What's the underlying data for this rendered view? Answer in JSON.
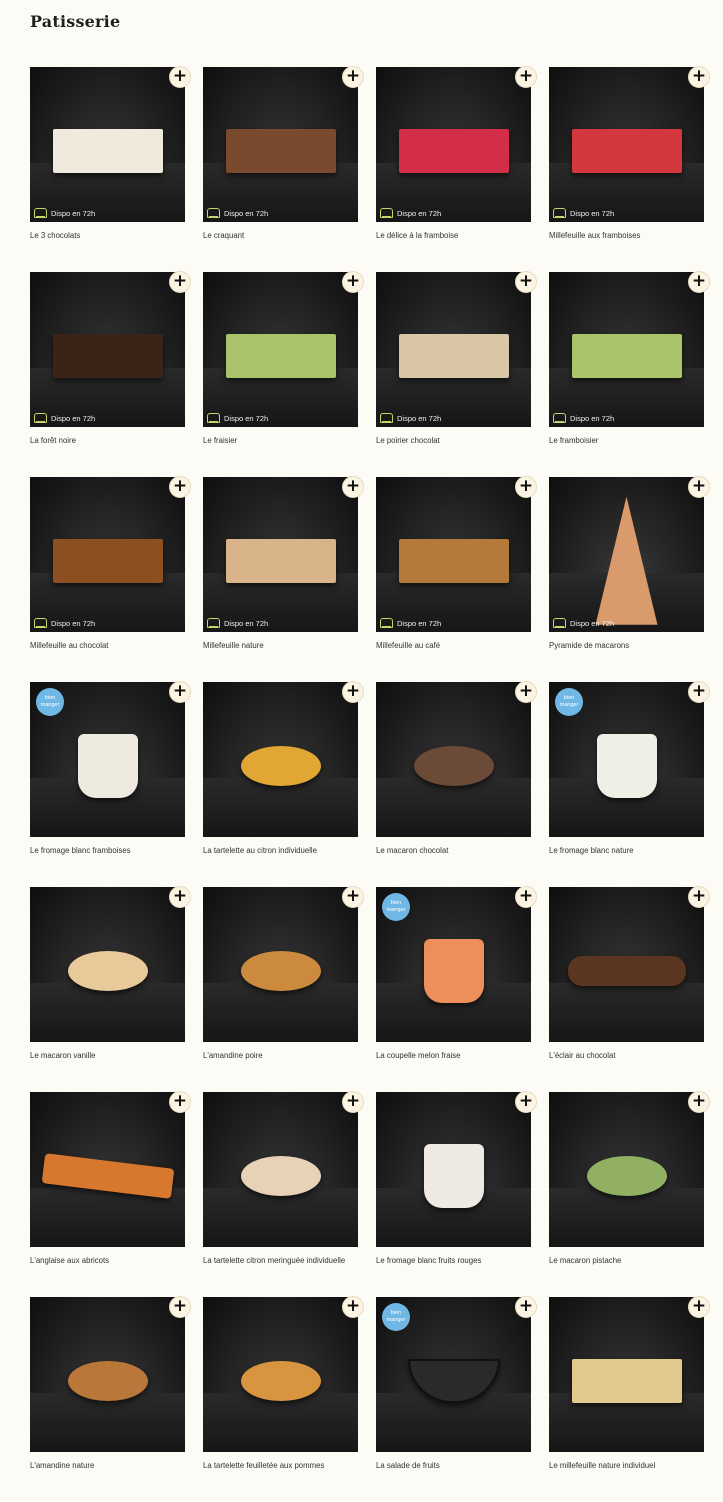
{
  "page": {
    "title": "Patisserie"
  },
  "availability_label": "Dispo en 72h",
  "badge_label": "bien manger",
  "products": [
    {
      "name": "Le 3 chocolats",
      "dispo": true,
      "badge": false,
      "shape": "slab",
      "color": "#efeadb"
    },
    {
      "name": "Le craquant",
      "dispo": true,
      "badge": false,
      "shape": "slab",
      "color": "#7a4a2e"
    },
    {
      "name": "Le délice à la framboise",
      "dispo": true,
      "badge": false,
      "shape": "slab",
      "color": "#d32d48"
    },
    {
      "name": "Millefeuille aux framboises",
      "dispo": true,
      "badge": false,
      "shape": "slab",
      "color": "#d3383f"
    },
    {
      "name": "La forêt noire",
      "dispo": true,
      "badge": false,
      "shape": "slab",
      "color": "#3a2418"
    },
    {
      "name": "Le fraisier",
      "dispo": true,
      "badge": false,
      "shape": "slab",
      "color": "#a8c36a"
    },
    {
      "name": "Le poirier chocolat",
      "dispo": true,
      "badge": false,
      "shape": "slab",
      "color": "#d8c6a4"
    },
    {
      "name": "Le framboisier",
      "dispo": true,
      "badge": false,
      "shape": "slab",
      "color": "#a9c46b"
    },
    {
      "name": "Millefeuille au chocolat",
      "dispo": true,
      "badge": false,
      "shape": "slab",
      "color": "#8b4f22"
    },
    {
      "name": "Millefeuille nature",
      "dispo": true,
      "badge": false,
      "shape": "slab",
      "color": "#d9b48a"
    },
    {
      "name": "Millefeuille au café",
      "dispo": true,
      "badge": false,
      "shape": "slab",
      "color": "#b57a3a"
    },
    {
      "name": "Pyramide de macarons",
      "dispo": true,
      "badge": false,
      "shape": "tower",
      "color": "#d99a6c"
    },
    {
      "name": "Le fromage blanc framboises",
      "dispo": false,
      "badge": true,
      "shape": "cup",
      "color": "#eeeae0"
    },
    {
      "name": "La tartelette au citron individuelle",
      "dispo": false,
      "badge": false,
      "shape": "round",
      "color": "#e2a634"
    },
    {
      "name": "Le macaron chocolat",
      "dispo": false,
      "badge": false,
      "shape": "round",
      "color": "#6b4a37"
    },
    {
      "name": "Le fromage blanc nature",
      "dispo": false,
      "badge": true,
      "shape": "cup",
      "color": "#eef0e6"
    },
    {
      "name": "Le macaron vanille",
      "dispo": false,
      "badge": false,
      "shape": "round",
      "color": "#e7c99a"
    },
    {
      "name": "L'amandine poire",
      "dispo": false,
      "badge": false,
      "shape": "round",
      "color": "#cc8a3e"
    },
    {
      "name": "La coupelle melon fraise",
      "dispo": false,
      "badge": true,
      "shape": "cup",
      "color": "#ec8f5a"
    },
    {
      "name": "L'éclair au chocolat",
      "dispo": false,
      "badge": false,
      "shape": "eclair",
      "color": "#5a3520"
    },
    {
      "name": "L'anglaise aux abricots",
      "dispo": false,
      "badge": false,
      "shape": "strip",
      "color": "#d8782e"
    },
    {
      "name": "La tartelette citron meringuée individuelle",
      "dispo": false,
      "badge": false,
      "shape": "round",
      "color": "#e7d2b8"
    },
    {
      "name": "Le fromage blanc fruits rouges",
      "dispo": false,
      "badge": false,
      "shape": "cup",
      "color": "#eee9e3"
    },
    {
      "name": "Le macaron pistache",
      "dispo": false,
      "badge": false,
      "shape": "round",
      "color": "#92b062"
    },
    {
      "name": "L'amandine nature",
      "dispo": false,
      "badge": false,
      "shape": "round",
      "color": "#b9773a"
    },
    {
      "name": "La tartelette feuilletée aux pommes",
      "dispo": false,
      "badge": false,
      "shape": "round",
      "color": "#d99440"
    },
    {
      "name": "La salade de fruits",
      "dispo": false,
      "badge": true,
      "shape": "bowl",
      "color": "#2a2a2a"
    },
    {
      "name": "Le millefeuille nature individuel",
      "dispo": false,
      "badge": false,
      "shape": "slab",
      "color": "#e3c98e"
    }
  ]
}
